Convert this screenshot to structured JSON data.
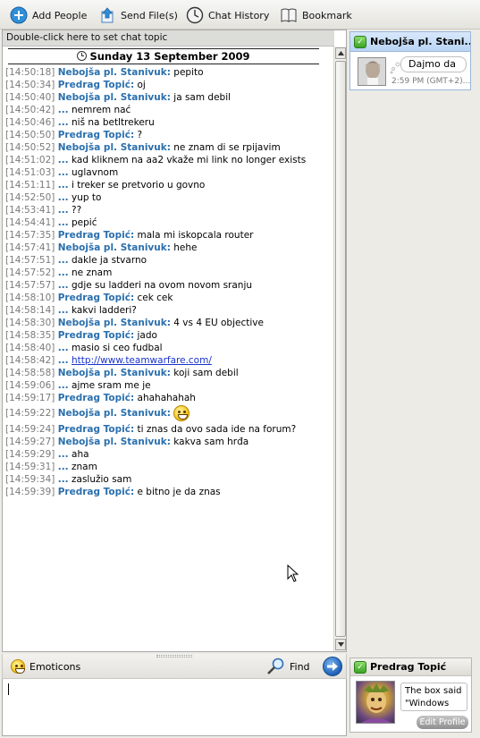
{
  "toolbar": {
    "add_people": "Add People",
    "send_files": "Send File(s)",
    "chat_history": "Chat History",
    "bookmark": "Bookmark"
  },
  "chat": {
    "topic_hint": "Double-click here to set chat topic",
    "date": "Sunday 13 September 2009",
    "messages": [
      {
        "time": "[14:50:18]",
        "sender": "Nebojša pl. Stanivuk:",
        "text": " pepito"
      },
      {
        "time": "[14:50:34]",
        "sender": "Predrag Topić:",
        "text": " oj"
      },
      {
        "time": "[14:50:40]",
        "sender": "Nebojša pl. Stanivuk:",
        "text": " ja sam debil"
      },
      {
        "time": "[14:50:42]",
        "sender": "...",
        "text": " nemrem nać"
      },
      {
        "time": "[14:50:46]",
        "sender": "...",
        "text": " niš na betltrekeru"
      },
      {
        "time": "[14:50:50]",
        "sender": "Predrag Topić:",
        "text": " ?"
      },
      {
        "time": "[14:50:52]",
        "sender": "Nebojša pl. Stanivuk:",
        "text": " ne znam di se rpijavim"
      },
      {
        "time": "[14:51:02]",
        "sender": "...",
        "text": " kad kliknem na aa2 vkaže mi link no longer exists"
      },
      {
        "time": "[14:51:03]",
        "sender": "...",
        "text": " uglavnom"
      },
      {
        "time": "[14:51:11]",
        "sender": "...",
        "text": " i treker se pretvorio u govno"
      },
      {
        "time": "[14:52:50]",
        "sender": "...",
        "text": " yup to"
      },
      {
        "time": "[14:53:41]",
        "sender": "...",
        "text": " ??"
      },
      {
        "time": "[14:54:41]",
        "sender": "...",
        "text": " pepić"
      },
      {
        "time": "[14:57:35]",
        "sender": "Predrag Topić:",
        "text": " mala mi iskopcala router"
      },
      {
        "time": "[14:57:41]",
        "sender": "Nebojša pl. Stanivuk:",
        "text": " hehe"
      },
      {
        "time": "[14:57:51]",
        "sender": "...",
        "text": " dakle ja stvarno"
      },
      {
        "time": "[14:57:52]",
        "sender": "...",
        "text": " ne znam"
      },
      {
        "time": "[14:57:57]",
        "sender": "...",
        "text": " gdje su ladderi na ovom novom sranju"
      },
      {
        "time": "[14:58:10]",
        "sender": "Predrag Topić:",
        "text": " cek cek"
      },
      {
        "time": "[14:58:14]",
        "sender": "...",
        "text": " kakvi ladderi?"
      },
      {
        "time": "[14:58:30]",
        "sender": "Nebojša pl. Stanivuk:",
        "text": " 4 vs 4 EU objective"
      },
      {
        "time": "[14:58:35]",
        "sender": "Predrag Topić:",
        "text": " jado"
      },
      {
        "time": "[14:58:40]",
        "sender": "...",
        "text": " masio si ceo fudbal"
      },
      {
        "time": "[14:58:42]",
        "sender": "...",
        "text": " ",
        "link": "http://www.teamwarfare.com/"
      },
      {
        "time": "[14:58:58]",
        "sender": "Nebojša pl. Stanivuk:",
        "text": " koji sam debil"
      },
      {
        "time": "[14:59:06]",
        "sender": "...",
        "text": " ajme sram me je"
      },
      {
        "time": "[14:59:17]",
        "sender": "Predrag Topić:",
        "text": " ahahahahah"
      },
      {
        "time": "[14:59:22]",
        "sender": "Nebojša pl. Stanivuk:",
        "text": " ",
        "emoticon": "grin"
      },
      {
        "time": "[14:59:24]",
        "sender": "Predrag Topić:",
        "text": " ti znas da ovo sada ide na forum?"
      },
      {
        "time": "[14:59:27]",
        "sender": "Nebojša pl. Stanivuk:",
        "text": " kakva sam hrđa"
      },
      {
        "time": "[14:59:29]",
        "sender": "...",
        "text": " aha"
      },
      {
        "time": "[14:59:31]",
        "sender": "...",
        "text": " znam"
      },
      {
        "time": "[14:59:34]",
        "sender": "...",
        "text": " zaslužio sam"
      },
      {
        "time": "[14:59:39]",
        "sender": "Predrag Topić:",
        "text": " e bitno je da znas"
      }
    ]
  },
  "compose": {
    "emoticons_label": "Emoticons",
    "find_label": "Find"
  },
  "contact": {
    "name": "Nebojša pl. Stani...",
    "bubble": "Dajmo da",
    "time": "2:59 PM (GMT+2)..."
  },
  "self": {
    "name": "Predrag Topić",
    "status_message": "The box said \"Windows XP",
    "edit_profile": "Edit Profile"
  },
  "colors": {
    "sender": "#2a6fad",
    "timestamp": "#7a7a7a",
    "link": "#1a33cc",
    "online": "#3aa324"
  }
}
